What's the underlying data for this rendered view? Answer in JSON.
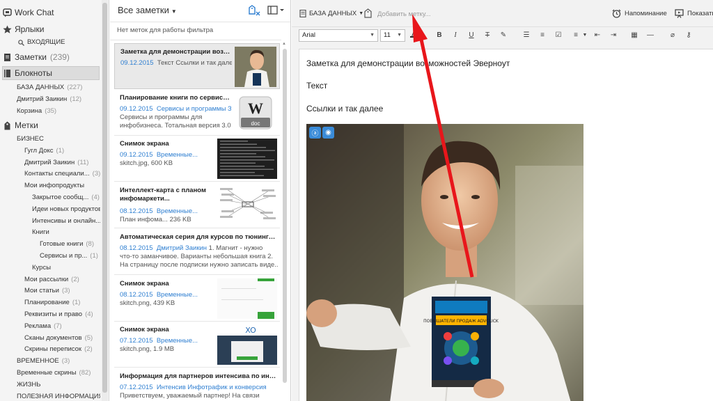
{
  "sidebar": {
    "work_chat": "Work Chat",
    "shortcuts": "Ярлыки",
    "inbox": "ВХОДЯЩИЕ",
    "notes": {
      "label": "Заметки",
      "count": "(239)"
    },
    "notebooks": "Блокноты",
    "notebook_items": [
      {
        "label": "БАЗА ДАННЫХ",
        "count": "(227)"
      },
      {
        "label": "Дмитрий Заикин",
        "count": "(12)"
      },
      {
        "label": "Корзина",
        "count": "(35)"
      }
    ],
    "tags": "Метки",
    "tag_items": [
      {
        "label": "БИЗНЕС",
        "count": ""
      },
      {
        "label": "Гугл Докс",
        "count": "(1)"
      },
      {
        "label": "Дмитрий Заикин",
        "count": "(11)"
      },
      {
        "label": "Контакты специали...",
        "count": "(3)"
      },
      {
        "label": "Мои инфопродукты",
        "count": ""
      },
      {
        "label": "Закрытое сообщ...",
        "count": "(4)"
      },
      {
        "label": "Идеи новых продуктов",
        "count": ""
      },
      {
        "label": "Интенсивы и онлайн...",
        "count": ""
      },
      {
        "label": "Книги",
        "count": ""
      },
      {
        "label": "Готовые книги",
        "count": "(8)"
      },
      {
        "label": "Сервисы и пр...",
        "count": "(1)"
      },
      {
        "label": "Курсы",
        "count": ""
      },
      {
        "label": "Мои рассылки",
        "count": "(2)"
      },
      {
        "label": "Мои статьи",
        "count": "(3)"
      },
      {
        "label": "Планирование",
        "count": "(1)"
      },
      {
        "label": "Реквизиты и право",
        "count": "(4)"
      },
      {
        "label": "Реклама",
        "count": "(7)"
      },
      {
        "label": "Сканы документов",
        "count": "(5)"
      },
      {
        "label": "Скрины переписок",
        "count": "(2)"
      },
      {
        "label": "ВРЕМЕННОЕ",
        "count": "(3)"
      },
      {
        "label": "Временные скрины",
        "count": "(82)"
      },
      {
        "label": "ЖИЗНЬ",
        "count": ""
      },
      {
        "label": "ПОЛЕЗНАЯ ИНФОРМАЦИЯ",
        "count": ""
      }
    ]
  },
  "notelist": {
    "title": "Все заметки",
    "filter_msg": "Нет меток для работы фильтра",
    "notes": [
      {
        "title": "Заметка для демонстрации возмож...",
        "date": "09.12.2015",
        "meta": "Текст Ссылки и так далее",
        "snip": []
      },
      {
        "title": "Планирование книги по сервисам д...",
        "date": "09.12.2015",
        "meta": "Сервисы и программы З...",
        "snip": [
          "Сервисы и программы для",
          "инфобизнеса. Тотальная версия 3.0...."
        ],
        "thumb_text": "doc"
      },
      {
        "title": "Снимок экрана",
        "date": "09.12.2015",
        "meta": "Временные...",
        "snip": [
          "skitch.jpg,  600 KB"
        ]
      },
      {
        "title": "Интеллект-карта с планом инфомаркети...",
        "date": "08.12.2015",
        "meta": "Временные...",
        "snip": [
          "План инфома...  236 KB"
        ]
      },
      {
        "title": "Автоматическая серия для курсов по тюнингу сал...",
        "date": "08.12.2015",
        "meta": "Дмитрий Заикин",
        "meta2": "1. Магнит - нужно",
        "snip": [
          "что-то заманчивое. Варианты небольшая книга 2.",
          "На страницу после подписки нужно записать виде..."
        ]
      },
      {
        "title": "Снимок экрана",
        "date": "08.12.2015",
        "meta": "Временные...",
        "snip": [
          "skitch.png,  439 KB"
        ]
      },
      {
        "title": "Снимок экрана",
        "date": "07.12.2015",
        "meta": "Временные...",
        "snip": [
          "skitch.png,  1.9 MB"
        ]
      },
      {
        "title": "Информация для партнеров интенсива по инфотр...",
        "date": "07.12.2015",
        "meta": "Интенсив Инфотрафик и конверсия",
        "snip": [
          "Приветствуем, уважаемый партнер! На связи"
        ]
      }
    ]
  },
  "editor": {
    "notebook": "БАЗА ДАННЫХ",
    "add_tag": "Добавить метку...",
    "reminder": "Напоминание",
    "show": "Показать",
    "font": "Arial",
    "size": "11",
    "doc_title": "Заметка для демонстрации возможностей Эверноут",
    "p1": "Текст",
    "p2": "Ссылки и так далее",
    "box_label": "ПОВЫШАТЕЛИ ПРОДАЖ ADVCLICK"
  },
  "colors": {
    "accent": "#2f7fd1",
    "arrow": "#e8161b"
  }
}
